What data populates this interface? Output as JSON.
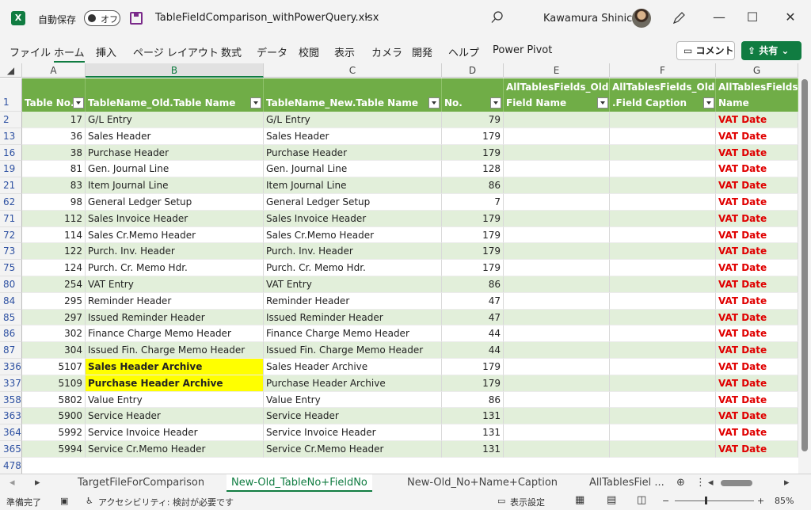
{
  "app": {
    "logo": "X",
    "autosave_label": "自動保存",
    "autosave_state": "オフ",
    "file_name": "TableFieldComparison_withPowerQuery.xlsx",
    "user_name": "Kawamura Shinichi"
  },
  "menu": [
    "ファイル",
    "ホーム",
    "挿入",
    "ページ レイアウト",
    "数式",
    "データ",
    "校閲",
    "表示",
    "カメラ",
    "開発",
    "ヘルプ",
    "Power Pivot"
  ],
  "menu_active": "ホーム",
  "comment_label": "コメント",
  "share_label": "共有",
  "columns": [
    "A",
    "B",
    "C",
    "D",
    "E",
    "F",
    "G"
  ],
  "header_row_number": "1",
  "headers": {
    "A": "Table No.",
    "B": "TableName_Old.Table Name",
    "C": "TableName_New.Table Name",
    "D": "No.",
    "E_line1": "AllTablesFields_Old.",
    "E_line2": "Field Name",
    "F_line1": "AllTablesFields_Old",
    "F_line2": ".Field Caption",
    "G_line1": "AllTablesFields",
    "G_line2": "Name"
  },
  "rows": [
    {
      "rn": "2",
      "a": "17",
      "b": "G/L Entry",
      "c": "G/L Entry",
      "d": "79",
      "g": "VAT Date",
      "hl": false
    },
    {
      "rn": "13",
      "a": "36",
      "b": "Sales Header",
      "c": "Sales Header",
      "d": "179",
      "g": "VAT Date",
      "hl": false
    },
    {
      "rn": "16",
      "a": "38",
      "b": "Purchase Header",
      "c": "Purchase Header",
      "d": "179",
      "g": "VAT Date",
      "hl": false
    },
    {
      "rn": "19",
      "a": "81",
      "b": "Gen. Journal Line",
      "c": "Gen. Journal Line",
      "d": "128",
      "g": "VAT Date",
      "hl": false
    },
    {
      "rn": "21",
      "a": "83",
      "b": "Item Journal Line",
      "c": "Item Journal Line",
      "d": "86",
      "g": "VAT Date",
      "hl": false
    },
    {
      "rn": "62",
      "a": "98",
      "b": "General Ledger Setup",
      "c": "General Ledger Setup",
      "d": "7",
      "g": "VAT Date",
      "hl": false
    },
    {
      "rn": "71",
      "a": "112",
      "b": "Sales Invoice Header",
      "c": "Sales Invoice Header",
      "d": "179",
      "g": "VAT Date",
      "hl": false
    },
    {
      "rn": "72",
      "a": "114",
      "b": "Sales Cr.Memo Header",
      "c": "Sales Cr.Memo Header",
      "d": "179",
      "g": "VAT Date",
      "hl": false
    },
    {
      "rn": "73",
      "a": "122",
      "b": "Purch. Inv. Header",
      "c": "Purch. Inv. Header",
      "d": "179",
      "g": "VAT Date",
      "hl": false
    },
    {
      "rn": "75",
      "a": "124",
      "b": "Purch. Cr. Memo Hdr.",
      "c": "Purch. Cr. Memo Hdr.",
      "d": "179",
      "g": "VAT Date",
      "hl": false
    },
    {
      "rn": "80",
      "a": "254",
      "b": "VAT Entry",
      "c": "VAT Entry",
      "d": "86",
      "g": "VAT Date",
      "hl": false
    },
    {
      "rn": "84",
      "a": "295",
      "b": "Reminder Header",
      "c": "Reminder Header",
      "d": "47",
      "g": "VAT Date",
      "hl": false
    },
    {
      "rn": "85",
      "a": "297",
      "b": "Issued Reminder Header",
      "c": "Issued Reminder Header",
      "d": "47",
      "g": "VAT Date",
      "hl": false
    },
    {
      "rn": "86",
      "a": "302",
      "b": "Finance Charge Memo Header",
      "c": "Finance Charge Memo Header",
      "d": "44",
      "g": "VAT Date",
      "hl": false
    },
    {
      "rn": "87",
      "a": "304",
      "b": "Issued Fin. Charge Memo Header",
      "c": "Issued Fin. Charge Memo Header",
      "d": "44",
      "g": "VAT Date",
      "hl": false
    },
    {
      "rn": "336",
      "a": "5107",
      "b": "Sales Header Archive",
      "c": "Sales Header Archive",
      "d": "179",
      "g": "VAT Date",
      "hl": true
    },
    {
      "rn": "337",
      "a": "5109",
      "b": "Purchase Header Archive",
      "c": "Purchase Header Archive",
      "d": "179",
      "g": "VAT Date",
      "hl": true
    },
    {
      "rn": "358",
      "a": "5802",
      "b": "Value Entry",
      "c": "Value Entry",
      "d": "86",
      "g": "VAT Date",
      "hl": false
    },
    {
      "rn": "363",
      "a": "5900",
      "b": "Service Header",
      "c": "Service Header",
      "d": "131",
      "g": "VAT Date",
      "hl": false
    },
    {
      "rn": "364",
      "a": "5992",
      "b": "Service Invoice Header",
      "c": "Service Invoice Header",
      "d": "131",
      "g": "VAT Date",
      "hl": false
    },
    {
      "rn": "365",
      "a": "5994",
      "b": "Service Cr.Memo Header",
      "c": "Service Cr.Memo Header",
      "d": "131",
      "g": "VAT Date",
      "hl": false
    }
  ],
  "last_row_number": "478",
  "sheet_tabs": [
    "TargetFileForComparison",
    "New-Old_TableNo+FieldNo",
    "New-Old_No+Name+Caption",
    "AllTablesFiel ..."
  ],
  "active_sheet": "New-Old_TableNo+FieldNo",
  "status": {
    "ready": "準備完了",
    "accessibility": "アクセシビリティ: 検討が必要です",
    "display_settings": "表示設定",
    "zoom": "85%"
  },
  "colors": {
    "header_green": "#70ad47",
    "band_light": "#e2efda",
    "accent": "#107c41",
    "vat_red": "#e00000",
    "highlight": "#ffff00"
  }
}
